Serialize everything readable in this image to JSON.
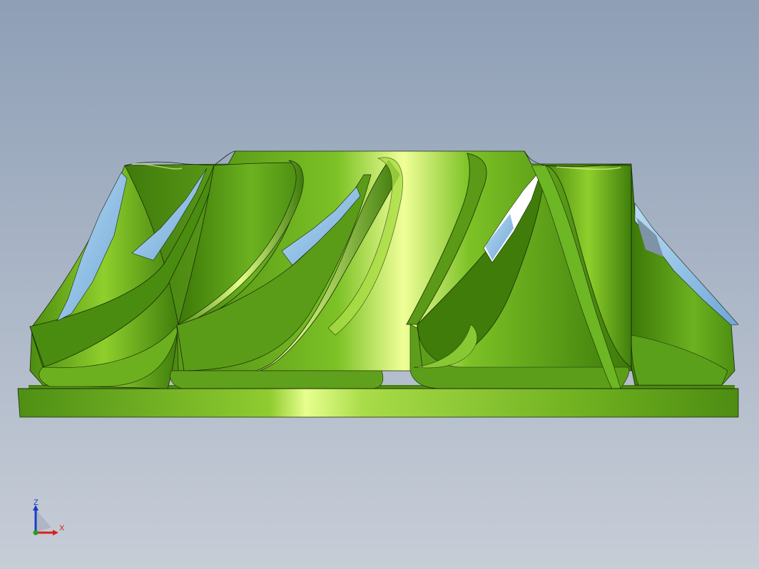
{
  "viewport": {
    "background_top": "#8e9fb6",
    "background_bottom": "#c6ccd6"
  },
  "model": {
    "name": "impeller",
    "body_color": "#5aa01a",
    "highlight_color": "#f2ff96",
    "shadow_color": "#2e5a08",
    "glass_color": "#8fc3ea",
    "edge_color": "#1a2a0a"
  },
  "triad": {
    "z_label": "Z",
    "x_label": "X",
    "z_color": "#1a3cc8",
    "x_color": "#d8201c",
    "y_color": "#20a020"
  }
}
